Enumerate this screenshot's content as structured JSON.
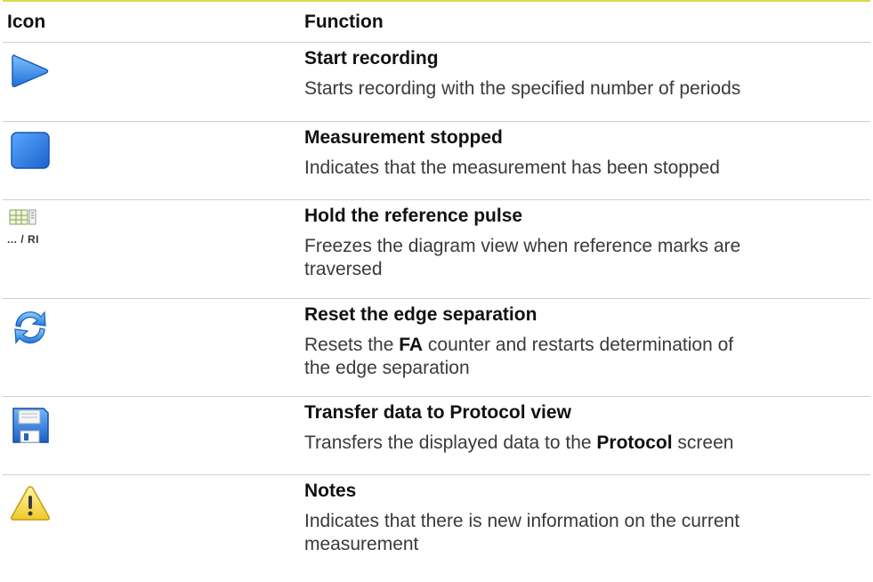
{
  "headers": {
    "icon": "Icon",
    "function": "Function"
  },
  "rows": [
    {
      "icon": "play-icon",
      "name": "Start recording",
      "desc": [
        "Starts recording with the specified number of periods"
      ]
    },
    {
      "icon": "stop-icon",
      "name": "Measurement stopped",
      "desc": [
        "Indicates that the measurement has been stopped"
      ]
    },
    {
      "icon": "hold-reference-pulse-icon",
      "icon_text": "... / RI",
      "name": "Hold the reference pulse",
      "desc": [
        "Freezes the diagram view when reference marks are",
        "traversed"
      ]
    },
    {
      "icon": "refresh-icon",
      "name": "Reset the edge separation",
      "desc_pre": "Resets the ",
      "desc_bold": "FA",
      "desc_post": " counter and restarts determination of",
      "desc2": "the edge separation"
    },
    {
      "icon": "floppy-disk-icon",
      "name": "Transfer data to Protocol view",
      "desc_pre": "Transfers the displayed data to the ",
      "desc_bold": "Protocol",
      "desc_post": " screen"
    },
    {
      "icon": "warning-icon",
      "name": "Notes",
      "desc": [
        "Indicates that there is new information on the current",
        "measurement"
      ]
    }
  ],
  "colors": {
    "rule": "#e0d94a",
    "blue": "#2f7fe0",
    "warning": "#f2d23c"
  }
}
